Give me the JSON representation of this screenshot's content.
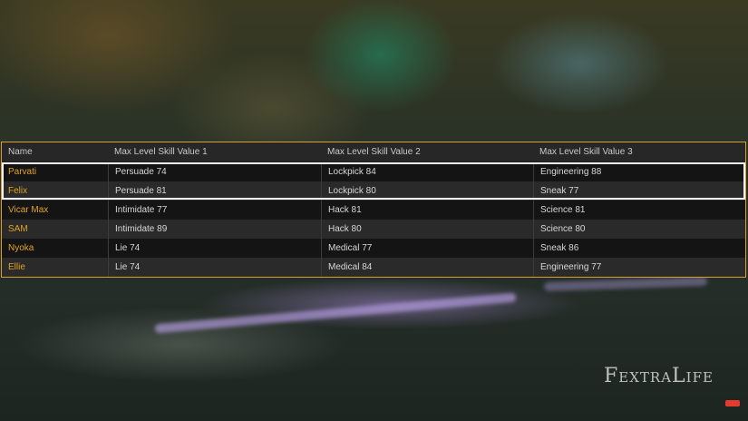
{
  "table": {
    "headers": [
      "Name",
      "Max Level Skill Value 1",
      "Max Level Skill Value 2",
      "Max Level Skill Value 3"
    ],
    "rows": [
      {
        "name": "Parvati",
        "s1": "Persuade 74",
        "s2": "Lockpick 84",
        "s3": "Engineering 88"
      },
      {
        "name": "Felix",
        "s1": "Persuade 81",
        "s2": "Lockpick 80",
        "s3": "Sneak 77"
      },
      {
        "name": "Vicar Max",
        "s1": "Intimidate 77",
        "s2": "Hack 81",
        "s3": "Science 81"
      },
      {
        "name": "SAM",
        "s1": "Intimidate 89",
        "s2": "Hack 80",
        "s3": "Science 80"
      },
      {
        "name": "Nyoka",
        "s1": "Lie 74",
        "s2": "Medical 77",
        "s3": "Sneak 86"
      },
      {
        "name": "Ellie",
        "s1": "Lie 74",
        "s2": "Medical 84",
        "s3": "Engineering 77"
      }
    ]
  },
  "watermark": {
    "prefix": "F",
    "mid": "EXTRA",
    "l": "L",
    "suffix": "IFE"
  },
  "colors": {
    "accent": "#d9a12b",
    "name_text": "#e0a322",
    "highlight": "#f2f2f2"
  }
}
